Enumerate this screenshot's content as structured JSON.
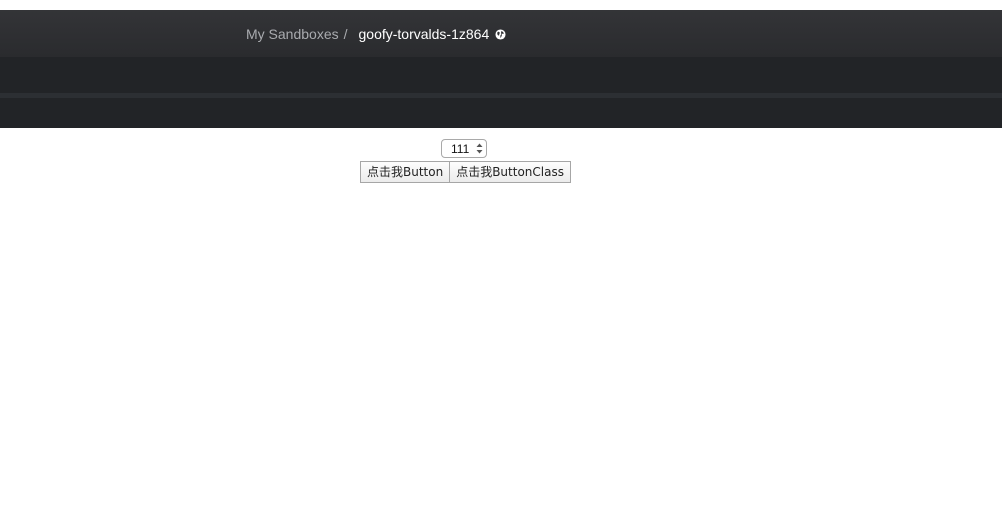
{
  "breadcrumb": {
    "parent": "My Sandboxes",
    "separator": "/",
    "current": "goofy-torvalds-1z864",
    "privacy_icon": "globe-icon"
  },
  "preview": {
    "number_input": {
      "value": "111"
    },
    "buttons": [
      {
        "label": "点击我Button"
      },
      {
        "label": "点击我ButtonClass"
      }
    ]
  },
  "colors": {
    "header_bg": "#2f3033",
    "toolbar_bg": "#222427",
    "breadcrumb_parent": "#a9abaf",
    "breadcrumb_current": "#ffffff"
  }
}
